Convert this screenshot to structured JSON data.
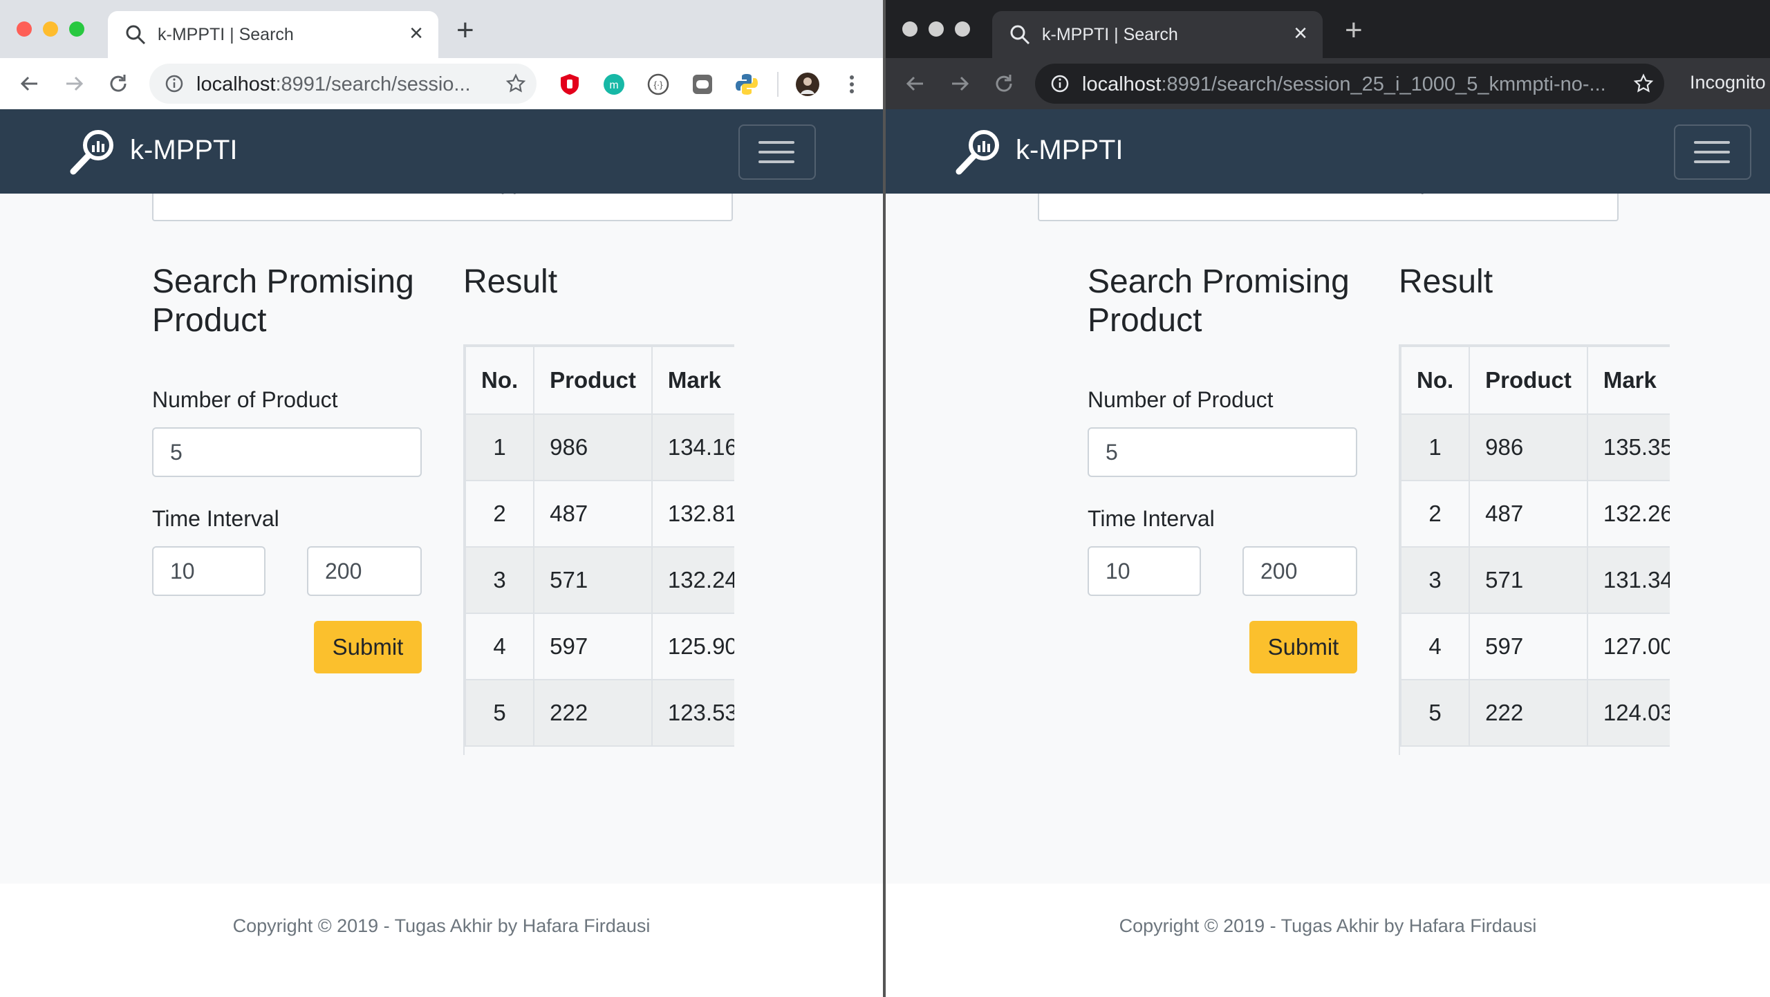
{
  "windows": [
    {
      "theme": "light",
      "tab_title": "k-MPPTI | Search",
      "url_host": "localhost",
      "url_path": ":8991/search/sessio...",
      "incognito_label": "",
      "brand": "k-MPPTI",
      "session_value": "session_23_i_1000_5_kmppti-no-thread",
      "search_heading": "Search Promising Product",
      "result_heading": "Result",
      "number_label": "Number of Product",
      "number_value": "5",
      "interval_label": "Time Interval",
      "interval_start": "10",
      "interval_end": "200",
      "submit_label": "Submit",
      "table_headers": [
        "No.",
        "Product",
        "Mark"
      ],
      "rows": [
        [
          "1",
          "986",
          "134.16"
        ],
        [
          "2",
          "487",
          "132.81"
        ],
        [
          "3",
          "571",
          "132.24"
        ],
        [
          "4",
          "597",
          "125.90"
        ],
        [
          "5",
          "222",
          "123.53"
        ]
      ],
      "footer": "Copyright © 2019 - Tugas Akhir by Hafara Firdausi"
    },
    {
      "theme": "dark",
      "tab_title": "k-MPPTI | Search",
      "url_host": "localhost",
      "url_path": ":8991/search/session_25_i_1000_5_kmmpti-no-...",
      "incognito_label": "Incognito",
      "brand": "k-MPPTI",
      "session_value": "session_25_i_1000_5_kmmpti-no-rsi",
      "search_heading": "Search Promising Product",
      "result_heading": "Result",
      "number_label": "Number of Product",
      "number_value": "5",
      "interval_label": "Time Interval",
      "interval_start": "10",
      "interval_end": "200",
      "submit_label": "Submit",
      "table_headers": [
        "No.",
        "Product",
        "Mark"
      ],
      "rows": [
        [
          "1",
          "986",
          "135.35"
        ],
        [
          "2",
          "487",
          "132.26"
        ],
        [
          "3",
          "571",
          "131.34"
        ],
        [
          "4",
          "597",
          "127.00"
        ],
        [
          "5",
          "222",
          "124.03"
        ]
      ],
      "footer": "Copyright © 2019 - Tugas Akhir by Hafara Firdausi"
    }
  ],
  "colors": {
    "navbar": "#2c3e50",
    "submit": "#fbc02d",
    "page_bg": "#f8f9fa"
  }
}
